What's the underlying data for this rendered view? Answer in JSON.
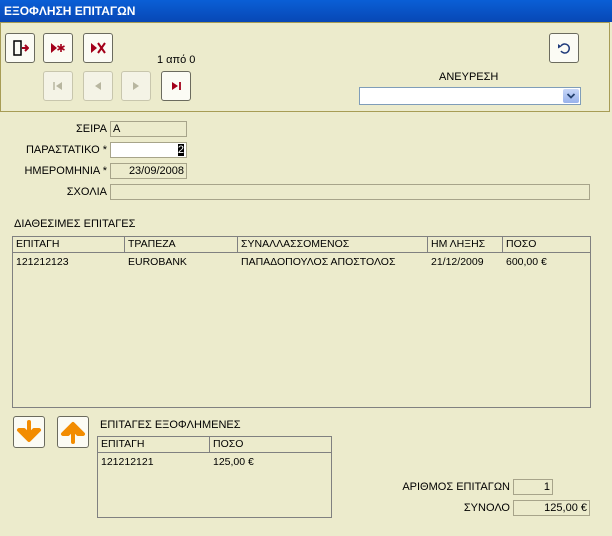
{
  "window": {
    "title": "ΕΞΟΦΛΗΣΗ ΕΠΙΤΑΓΩΝ"
  },
  "navigator": {
    "record_count": "1 από 0"
  },
  "search": {
    "label": "ΑΝΕΥΡΕΣΗ",
    "value": ""
  },
  "form": {
    "series_label": "ΣΕΙΡΑ",
    "series_value": "Α",
    "document_label": "ΠΑΡΑΣΤΑΤΙΚΟ *",
    "document_value": "2",
    "date_label": "ΗΜΕΡΟΜΗΝΙΑ *",
    "date_value": "23/09/2008",
    "comments_label": "ΣΧΟΛΙΑ",
    "comments_value": ""
  },
  "available": {
    "title": "ΔΙΑΘΕΣΙΜΕΣ ΕΠΙΤΑΓΕΣ",
    "columns": [
      "ΕΠΙΤΑΓΗ",
      "ΤΡΑΠΕΖΑ",
      "ΣΥΝΑΛΛΑΣΣΟΜΕΝΟΣ",
      "ΗΜ ΛΗΞΗΣ",
      "ΠΟΣΟ"
    ],
    "rows": [
      [
        "121212123",
        "EUROBANK",
        "ΠΑΠΑΔΟΠΟΥΛΟΣ ΑΠΟΣΤΟΛΟΣ",
        "21/12/2009",
        "600,00 €"
      ]
    ]
  },
  "paid": {
    "title": "ΕΠΙΤΑΓΕΣ ΕΞΟΦΛΗΜΕΝΕΣ",
    "columns": [
      "ΕΠΙΤΑΓΗ",
      "ΠΟΣΟ"
    ],
    "rows": [
      [
        "121212121",
        "125,00 €"
      ]
    ]
  },
  "summary": {
    "count_label": "ΑΡΙΘΜΟΣ ΕΠΙΤΑΓΩΝ",
    "count_value": "1",
    "total_label": "ΣΥΝΟΛΟ",
    "total_value": "125,00 €"
  },
  "colors": {
    "title_bar": "#0847b5",
    "form_bg": "#ecebcc",
    "red_icon": "#a3001a",
    "arrow_orange": "#f28c00"
  },
  "icons": [
    "exit-icon",
    "new-record-icon",
    "delete-record-icon",
    "undo-icon",
    "first-record-icon",
    "previous-record-icon",
    "next-record-icon",
    "last-record-icon",
    "move-down-icon",
    "move-up-icon",
    "dropdown-arrow-icon"
  ]
}
